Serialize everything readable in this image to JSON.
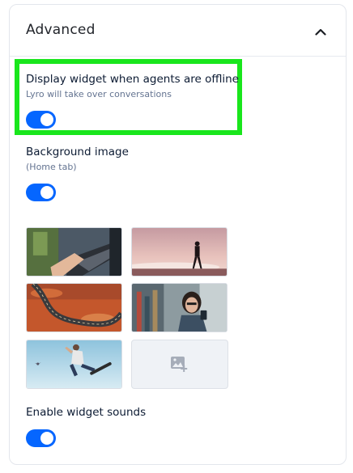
{
  "section": {
    "title": "Advanced",
    "collapse_icon": "chevron-up-icon"
  },
  "settings": {
    "offline_widget": {
      "title": "Display widget when agents are offline",
      "subtitle": "Lyro will take over conversations",
      "enabled": true
    },
    "background_image": {
      "title": "Background image",
      "subtitle": "(Home tab)",
      "enabled": true,
      "images": [
        "laptop-typing-image",
        "silhouette-sunset-image",
        "desert-road-image",
        "woman-phone-image",
        "skateboarder-jump-image"
      ],
      "upload_icon": "add-image-icon"
    },
    "widget_sounds": {
      "title": "Enable widget sounds",
      "enabled": true
    }
  },
  "colors": {
    "toggle_on": "#0566ff",
    "highlight": "#19e61c"
  }
}
